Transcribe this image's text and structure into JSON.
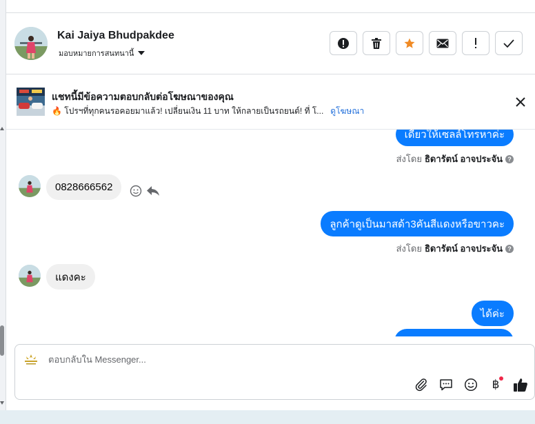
{
  "header": {
    "contact_name": "Kai Jaiya Bhudpakdee",
    "assign_label": "มอบหมายการสนทนานี้",
    "actions": [
      {
        "name": "report-spam-button",
        "icon": "alert-circle-icon"
      },
      {
        "name": "delete-button",
        "icon": "trash-icon"
      },
      {
        "name": "star-button",
        "icon": "star-icon"
      },
      {
        "name": "mark-unread-button",
        "icon": "envelope-icon"
      },
      {
        "name": "follow-up-button",
        "icon": "exclamation-icon"
      },
      {
        "name": "mark-done-button",
        "icon": "check-icon"
      }
    ]
  },
  "ad_banner": {
    "title": "แชทนี้มีข้อความตอบกลับต่อโฆษณาของคุณ",
    "description": "🔥 โปรฯที่ทุกคนรอคอยมาแล้ว! เปลี่ยนเงิน 11 บาท ให้กลายเป็นรถยนต์! ที่ โ...",
    "link_label": "ดูโฆษณา",
    "thumb_icon": "ad-thumbnail"
  },
  "messages": [
    {
      "direction": "out",
      "text": "เดี๋ยวให้เซลล์โทรหาค่ะ"
    },
    {
      "direction": "meta",
      "sent_by_label": "ส่งโดย",
      "sender": "ธิดารัตน์ อาจประจัน"
    },
    {
      "direction": "in",
      "text": "0828666562"
    },
    {
      "direction": "out",
      "text": "ลูกค้าดูเป็นมาสด้า3คันสีแดงหรือขาวคะ"
    },
    {
      "direction": "meta",
      "sent_by_label": "ส่งโดย",
      "sender": "ธิดารัตน์ อาจประจัน"
    },
    {
      "direction": "in",
      "text": "แดงคะ"
    },
    {
      "direction": "out",
      "text": "ได้ค่ะ"
    }
  ],
  "info_glyph": "?",
  "composer": {
    "placeholder": "ตอบกลับใน Messenger...",
    "tools": [
      "paperclip-icon",
      "saved-replies-icon",
      "emoji-icon",
      "baht-icon",
      "thumbs-up-icon"
    ],
    "baht_symbol": "฿"
  },
  "colors": {
    "outgoing_bubble": "#0a7cff",
    "incoming_bubble": "#f0f0f0",
    "star": "#f08a24",
    "accent_link": "#216fdb",
    "notification_dot": "#f02849"
  }
}
